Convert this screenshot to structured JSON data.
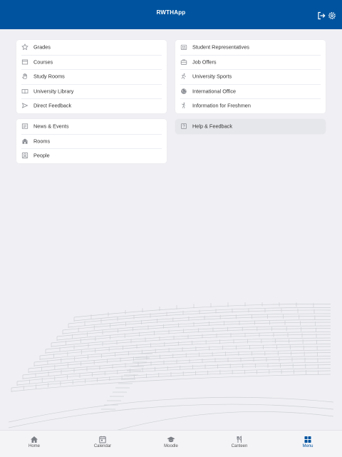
{
  "header": {
    "title": "RWTHApp",
    "logout_icon": "logout-icon",
    "settings_icon": "gear-icon"
  },
  "menu": {
    "left_group_1": [
      {
        "label": "Grades",
        "icon": "star-icon"
      },
      {
        "label": "Courses",
        "icon": "courses-icon"
      },
      {
        "label": "Study Rooms",
        "icon": "hand-icon"
      },
      {
        "label": "University Library",
        "icon": "book-icon"
      },
      {
        "label": "Direct Feedback",
        "icon": "send-icon"
      }
    ],
    "left_group_2": [
      {
        "label": "News & Events",
        "icon": "newspaper-icon"
      },
      {
        "label": "Rooms",
        "icon": "building-icon"
      },
      {
        "label": "People",
        "icon": "person-icon"
      }
    ],
    "right_group_1": [
      {
        "label": "Student Representatives",
        "icon": "group-icon"
      },
      {
        "label": "Job Offers",
        "icon": "briefcase-icon"
      },
      {
        "label": "University Sports",
        "icon": "sports-icon"
      },
      {
        "label": "International Office",
        "icon": "globe-icon"
      },
      {
        "label": "Information for Freshmen",
        "icon": "freshmen-icon"
      }
    ],
    "right_group_2": [
      {
        "label": "Help & Feedback",
        "icon": "help-icon",
        "selected": true
      }
    ]
  },
  "bottom_nav": [
    {
      "label": "Home",
      "icon": "home-icon"
    },
    {
      "label": "Calendar",
      "icon": "calendar-icon"
    },
    {
      "label": "Moodle",
      "icon": "graduation-cap-icon"
    },
    {
      "label": "Canteen",
      "icon": "cutlery-icon"
    },
    {
      "label": "Menu",
      "icon": "grid-icon",
      "active": true
    }
  ],
  "colors": {
    "primary": "#00549f",
    "background": "#f0f0f4",
    "card": "#ffffff",
    "icon": "#8a8d93"
  }
}
